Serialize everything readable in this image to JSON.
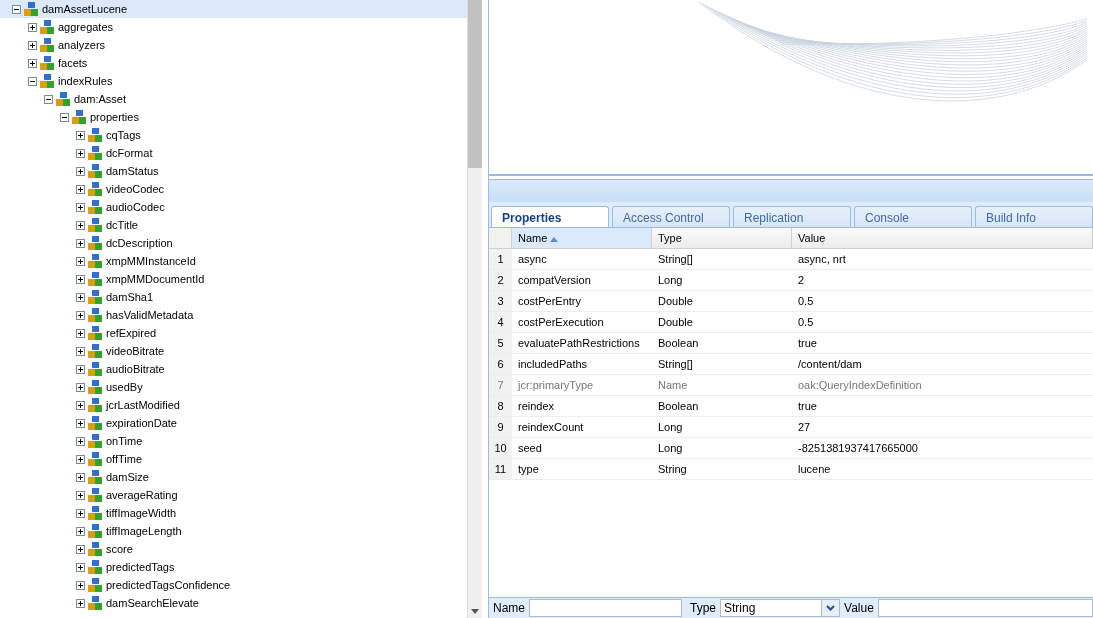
{
  "tree": {
    "label": "damAssetLucene",
    "expanded": true,
    "selected": true,
    "children": [
      {
        "label": "aggregates",
        "expanded": false,
        "selected": false
      },
      {
        "label": "analyzers",
        "expanded": false,
        "selected": false
      },
      {
        "label": "facets",
        "expanded": false,
        "selected": false
      },
      {
        "label": "indexRules",
        "expanded": true,
        "selected": false,
        "children": [
          {
            "label": "dam:Asset",
            "expanded": true,
            "selected": false,
            "children": [
              {
                "label": "properties",
                "expanded": true,
                "selected": false,
                "children": [
                  {
                    "label": "cqTags",
                    "expanded": false,
                    "selected": false
                  },
                  {
                    "label": "dcFormat",
                    "expanded": false,
                    "selected": false
                  },
                  {
                    "label": "damStatus",
                    "expanded": false,
                    "selected": false
                  },
                  {
                    "label": "videoCodec",
                    "expanded": false,
                    "selected": false
                  },
                  {
                    "label": "audioCodec",
                    "expanded": false,
                    "selected": false
                  },
                  {
                    "label": "dcTitle",
                    "expanded": false,
                    "selected": false
                  },
                  {
                    "label": "dcDescription",
                    "expanded": false,
                    "selected": false
                  },
                  {
                    "label": "xmpMMInstanceId",
                    "expanded": false,
                    "selected": false
                  },
                  {
                    "label": "xmpMMDocumentId",
                    "expanded": false,
                    "selected": false
                  },
                  {
                    "label": "damSha1",
                    "expanded": false,
                    "selected": false
                  },
                  {
                    "label": "hasValidMetadata",
                    "expanded": false,
                    "selected": false
                  },
                  {
                    "label": "refExpired",
                    "expanded": false,
                    "selected": false
                  },
                  {
                    "label": "videoBitrate",
                    "expanded": false,
                    "selected": false
                  },
                  {
                    "label": "audioBitrate",
                    "expanded": false,
                    "selected": false
                  },
                  {
                    "label": "usedBy",
                    "expanded": false,
                    "selected": false
                  },
                  {
                    "label": "jcrLastModified",
                    "expanded": false,
                    "selected": false
                  },
                  {
                    "label": "expirationDate",
                    "expanded": false,
                    "selected": false
                  },
                  {
                    "label": "onTime",
                    "expanded": false,
                    "selected": false
                  },
                  {
                    "label": "offTime",
                    "expanded": false,
                    "selected": false
                  },
                  {
                    "label": "damSize",
                    "expanded": false,
                    "selected": false
                  },
                  {
                    "label": "averageRating",
                    "expanded": false,
                    "selected": false
                  },
                  {
                    "label": "tiffImageWidth",
                    "expanded": false,
                    "selected": false
                  },
                  {
                    "label": "tiffImageLength",
                    "expanded": false,
                    "selected": false
                  },
                  {
                    "label": "score",
                    "expanded": false,
                    "selected": false
                  },
                  {
                    "label": "predictedTags",
                    "expanded": false,
                    "selected": false
                  },
                  {
                    "label": "predictedTagsConfidence",
                    "expanded": false,
                    "selected": false
                  },
                  {
                    "label": "damSearchElevate",
                    "expanded": false,
                    "selected": false
                  }
                ]
              }
            ]
          }
        ]
      }
    ]
  },
  "tabs": [
    {
      "label": "Properties",
      "selected": true
    },
    {
      "label": "Access Control",
      "selected": false
    },
    {
      "label": "Replication",
      "selected": false
    },
    {
      "label": "Console",
      "selected": false
    },
    {
      "label": "Build Info",
      "selected": false
    }
  ],
  "table": {
    "columns": [
      {
        "label": "Name",
        "sorted": true
      },
      {
        "label": "Type",
        "sorted": false
      },
      {
        "label": "Value",
        "sorted": false
      }
    ],
    "rows": [
      {
        "index": "1",
        "name": "async",
        "type": "String[]",
        "value": "async, nrt",
        "protected": false
      },
      {
        "index": "2",
        "name": "compatVersion",
        "type": "Long",
        "value": "2",
        "protected": false
      },
      {
        "index": "3",
        "name": "costPerEntry",
        "type": "Double",
        "value": "0.5",
        "protected": false
      },
      {
        "index": "4",
        "name": "costPerExecution",
        "type": "Double",
        "value": "0.5",
        "protected": false
      },
      {
        "index": "5",
        "name": "evaluatePathRestrictions",
        "type": "Boolean",
        "value": "true",
        "protected": false
      },
      {
        "index": "6",
        "name": "includedPaths",
        "type": "String[]",
        "value": "/content/dam",
        "protected": false
      },
      {
        "index": "7",
        "name": "jcr:primaryType",
        "type": "Name",
        "value": "oak:QueryIndexDefinition",
        "protected": true
      },
      {
        "index": "8",
        "name": "reindex",
        "type": "Boolean",
        "value": "true",
        "protected": false
      },
      {
        "index": "9",
        "name": "reindexCount",
        "type": "Long",
        "value": "27",
        "protected": false
      },
      {
        "index": "10",
        "name": "seed",
        "type": "Long",
        "value": "-8251381937417665000",
        "protected": false
      },
      {
        "index": "11",
        "name": "type",
        "type": "String",
        "value": "lucene",
        "protected": false
      }
    ]
  },
  "form": {
    "name_label": "Name",
    "type_label": "Type",
    "type_value": "String",
    "value_label": "Value"
  }
}
